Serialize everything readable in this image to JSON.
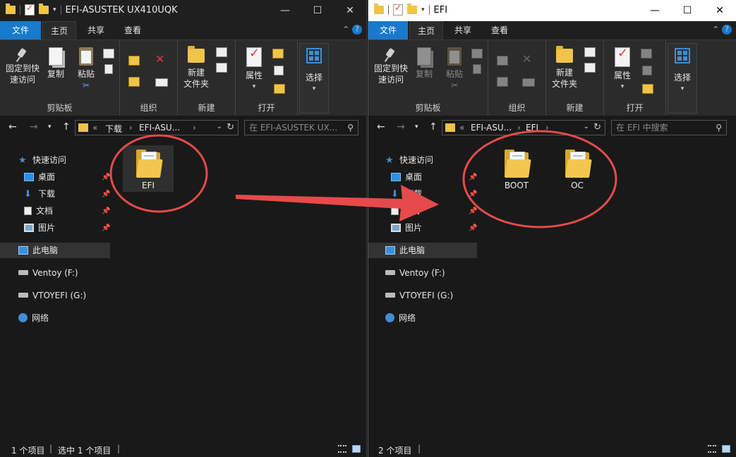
{
  "left_window": {
    "title": "EFI-ASUSTEK UX410UQK",
    "tabs": [
      "文件",
      "主页",
      "共享",
      "查看"
    ],
    "ribbon": {
      "clipboard": {
        "pin_label": "固定到快速访问",
        "pin_line1": "固定到快",
        "pin_line2": "速访问",
        "copy": "复制",
        "paste": "粘贴",
        "group": "剪贴板"
      },
      "organize_group": "组织",
      "new": {
        "folder_line1": "新建",
        "folder_line2": "文件夹",
        "group": "新建"
      },
      "open": {
        "properties": "属性",
        "group": "打开"
      },
      "select": "选择"
    },
    "address": {
      "crumbs": [
        "下载",
        "EFI-ASU..."
      ],
      "search_placeholder": "在 EFI-ASUSTEK UX..."
    },
    "nav": {
      "quick_access": "快速访问",
      "desktop": "桌面",
      "downloads": "下载",
      "documents": "文档",
      "pictures": "图片",
      "this_pc": "此电脑",
      "ventoy": "Ventoy (F:)",
      "vtoyefi": "VTOYEFI (G:)",
      "network": "网络"
    },
    "files": [
      {
        "name": "EFI",
        "icon": "folder-icon"
      }
    ],
    "status": {
      "count": "1 个项目",
      "selected": "选中 1 个项目"
    }
  },
  "right_window": {
    "title": "EFI",
    "tabs": [
      "文件",
      "主页",
      "共享",
      "查看"
    ],
    "ribbon": {
      "clipboard": {
        "pin_line1": "固定到快",
        "pin_line2": "速访问",
        "copy": "复制",
        "paste": "粘贴",
        "group": "剪贴板"
      },
      "organize_group": "组织",
      "new": {
        "folder_line1": "新建",
        "folder_line2": "文件夹",
        "group": "新建"
      },
      "open": {
        "properties": "属性",
        "group": "打开"
      },
      "select": "选择"
    },
    "address": {
      "crumbs": [
        "EFI-ASU...",
        "EFI"
      ],
      "search_placeholder": "在 EFI 中搜索"
    },
    "nav": {
      "quick_access": "快速访问",
      "desktop": "桌面",
      "downloads": "下载",
      "documents": "文档",
      "pictures": "图片",
      "this_pc": "此电脑",
      "ventoy": "Ventoy (F:)",
      "vtoyefi": "VTOYEFI (G:)",
      "network": "网络"
    },
    "files": [
      {
        "name": "BOOT",
        "icon": "folder-icon"
      },
      {
        "name": "OC",
        "icon": "folder-icon"
      }
    ],
    "status": {
      "count": "2 个项目"
    }
  },
  "colors": {
    "accent": "#1979ca",
    "annotation": "#e64a4a",
    "folder": "#f2c74f"
  }
}
